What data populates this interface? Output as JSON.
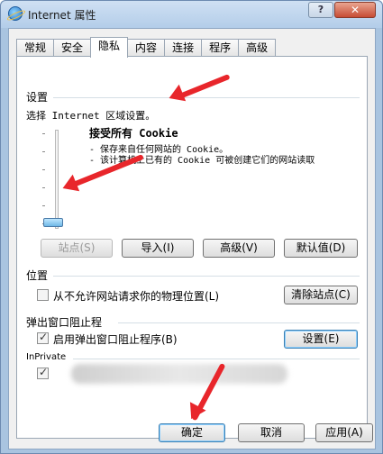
{
  "window": {
    "title": "Internet 属性",
    "help_glyph": "?",
    "close_glyph": "✕"
  },
  "tabs": [
    {
      "label": "常规",
      "active": false
    },
    {
      "label": "安全",
      "active": false
    },
    {
      "label": "隐私",
      "active": true
    },
    {
      "label": "内容",
      "active": false
    },
    {
      "label": "连接",
      "active": false
    },
    {
      "label": "程序",
      "active": false
    },
    {
      "label": "高级",
      "active": false
    }
  ],
  "settings": {
    "group_title": "设置",
    "zone_label": "选择 Internet 区域设置。",
    "slider_level_fraction": 0,
    "level_title": "接受所有 Cookie",
    "level_desc_1": "- 保存来自任何网站的 Cookie。",
    "level_desc_2": "- 该计算机上已有的 Cookie 可被创建它们的网站读取",
    "btn_sites": "站点(S)",
    "btn_import": "导入(I)",
    "btn_advanced": "高级(V)",
    "btn_default": "默认值(D)"
  },
  "location": {
    "group_title": "位置",
    "checkbox_label": "从不允许网站请求你的物理位置(L)",
    "checked": false,
    "btn_clear": "清除站点(C)"
  },
  "popup": {
    "group_title": "弹出窗口阻止程",
    "checkbox_label": "启用弹出窗口阻止程序(B)",
    "checked": true,
    "btn_settings": "设置(E)"
  },
  "inprivate": {
    "group_title": "InPrivate",
    "checked": true
  },
  "footer": {
    "ok": "确定",
    "cancel": "取消",
    "apply": "应用(A)"
  },
  "colors": {
    "annotation_arrow": "#e8262b",
    "accent": "#3c7fb1"
  }
}
